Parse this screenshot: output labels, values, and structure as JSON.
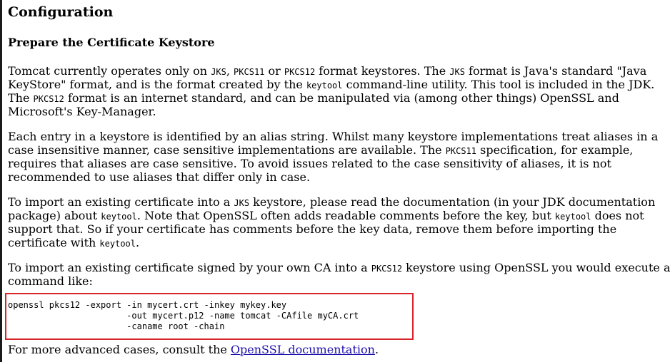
{
  "heading": "Configuration",
  "subheading": "Prepare the Certificate Keystore",
  "p1": {
    "l1": {
      "t1": "Tomcat currently operates only on ",
      "c1": "JKS",
      "t2": ", ",
      "c2": "PKCS11",
      "t3": " or ",
      "c3": "PKCS12",
      "t4": " format keystores. The ",
      "c4": "JKS",
      "t5": " format is Java's standard \"Java"
    },
    "l2": {
      "t1": "KeyStore\" format, and is the format created by the ",
      "c1": "keytool",
      "t2": " command-line utility. This tool is included in the JDK."
    },
    "l3": {
      "t1": "The ",
      "c1": "PKCS12",
      "t2": " format is an internet standard, and can be manipulated via (among other things) OpenSSL and"
    },
    "l4": {
      "t1": "Microsoft's Key-Manager."
    }
  },
  "p2": {
    "l1": {
      "t1": "Each entry in a keystore is identified by an alias string. Whilst many keystore implementations treat aliases in a"
    },
    "l2": {
      "t1": "case insensitive manner, case sensitive implementations are available. The ",
      "c1": "PKCS11",
      "t2": " specification, for example,"
    },
    "l3": {
      "t1": "requires that aliases are case sensitive. To avoid issues related to the case sensitivity of aliases, it is not"
    },
    "l4": {
      "t1": "recommended to use aliases that differ only in case."
    }
  },
  "p3": {
    "l1": {
      "t1": "To import an existing certificate into a ",
      "c1": "JKS",
      "t2": " keystore, please read the documentation (in your JDK documentation"
    },
    "l2": {
      "t1": "package) about ",
      "c1": "keytool",
      "t2": ". Note that OpenSSL often adds readable comments before the key, but ",
      "c2": "keytool",
      "t3": " does not"
    },
    "l3": {
      "t1": "support that. So if your certificate has comments before the key data, remove them before importing the"
    },
    "l4": {
      "t1": "certificate with ",
      "c1": "keytool",
      "t2": "."
    }
  },
  "p4": {
    "l1": {
      "t1": "To import an existing certificate signed by your own CA into a ",
      "c1": "PKCS12",
      "t2": " keystore using OpenSSL you would execute a"
    },
    "l2": {
      "t1": "command like:"
    }
  },
  "code": "openssl pkcs12 -export -in mycert.crt -inkey mykey.key\n                       -out mycert.p12 -name tomcat -CAfile myCA.crt\n                       -caname root -chain",
  "p5": {
    "t1": "For more advanced cases, consult the ",
    "link": "OpenSSL documentation",
    "t2": "."
  },
  "colors": {
    "code_border": "#d9232b",
    "link": "#1a0dab"
  }
}
